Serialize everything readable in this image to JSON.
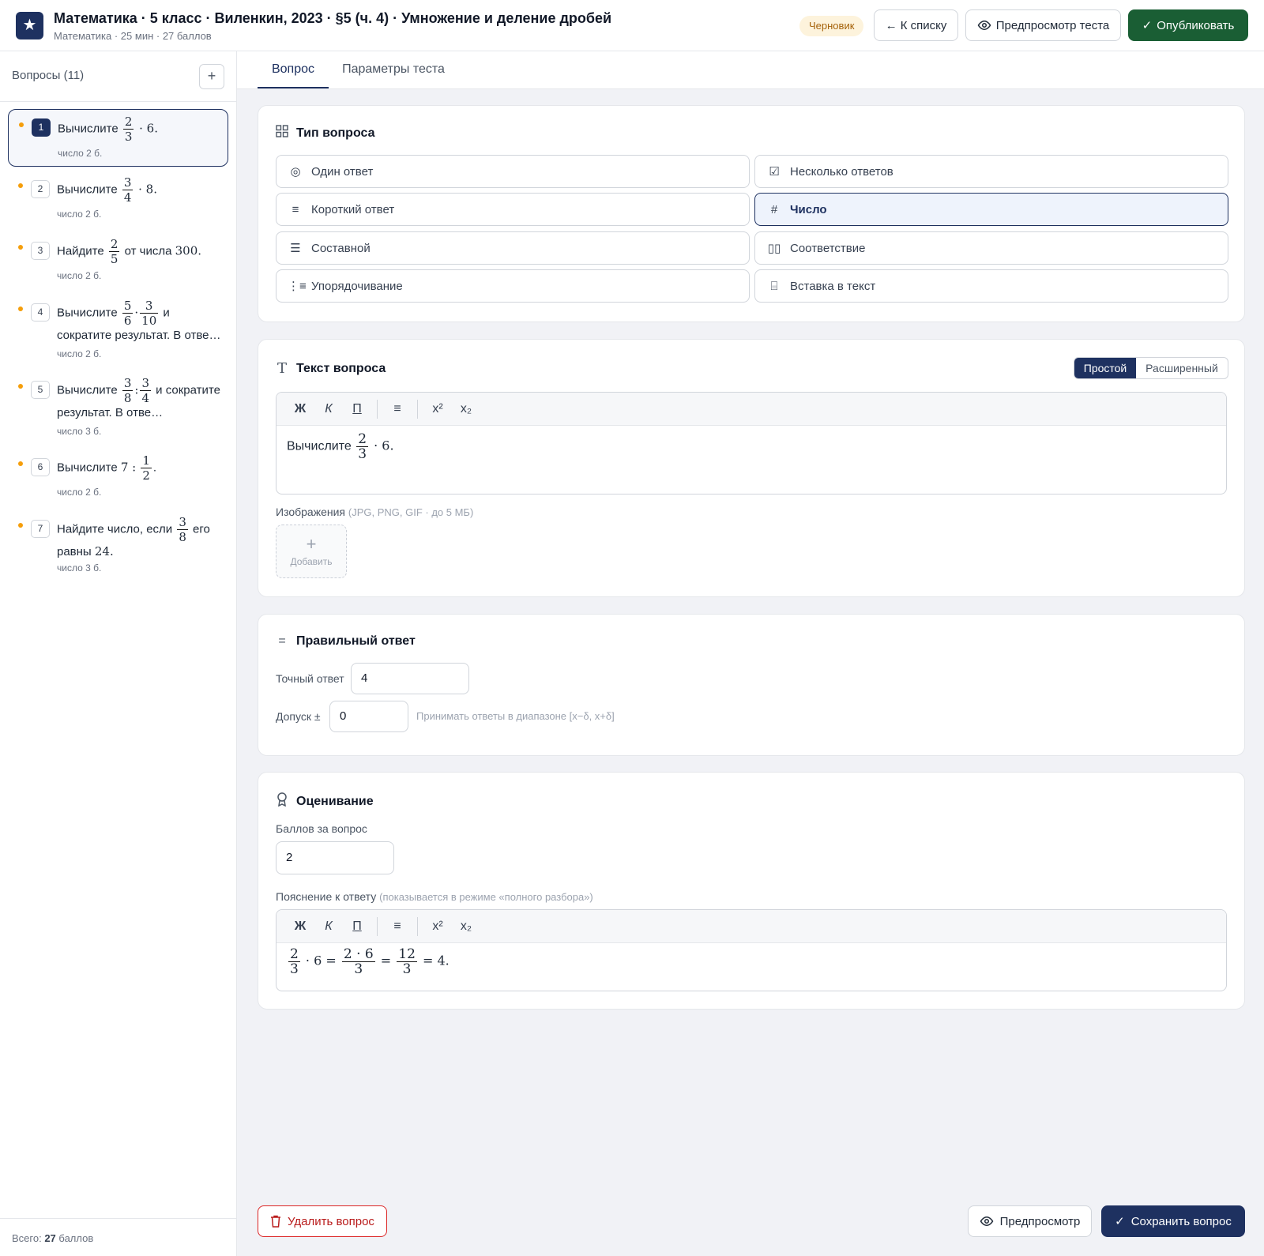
{
  "header": {
    "logo_icon": "star-icon",
    "title": "Математика · 5 класс · Виленкин, 2023 · §5 (ч. 4) · Умножение и деление дробей",
    "subtitle": "Математика · 25 мин · 27 баллов",
    "status": "Черновик",
    "back_label": "← К списку",
    "preview_label": "Предпросмотр теста",
    "publish_label": "Опубликовать"
  },
  "sidebar": {
    "title": "Вопросы (11)",
    "add_label": "+",
    "total_prefix": "Всего:",
    "total_value": "27",
    "total_suffix": "баллов",
    "questions": [
      {
        "num": "1",
        "meta": "число  2 б."
      },
      {
        "num": "2",
        "meta": "число  2 б."
      },
      {
        "num": "3",
        "meta": "число  2 б."
      },
      {
        "num": "4",
        "meta": "число  2 б."
      },
      {
        "num": "5",
        "meta": "число  3 б."
      },
      {
        "num": "6",
        "meta": "число  2 б."
      },
      {
        "num": "7",
        "meta": "число  3 б."
      }
    ]
  },
  "tabs": {
    "question": "Вопрос",
    "params": "Параметры теста"
  },
  "type_card": {
    "title": "Тип вопроса",
    "options": [
      "Один ответ",
      "Несколько ответов",
      "Короткий ответ",
      "Число",
      "Составной",
      "Соответствие",
      "Упорядочивание",
      "Вставка в текст"
    ],
    "selected": "Число"
  },
  "text_card": {
    "title": "Текст вопроса",
    "mode_simple": "Простой",
    "mode_advanced": "Расширенный",
    "toolbar": {
      "bold": "Ж",
      "italic": "К",
      "underline": "П",
      "list": "≡",
      "sup": "x²",
      "sub": "x₂"
    },
    "question_prefix": "Вычислите",
    "images_label": "Изображения",
    "images_hint": "(JPG, PNG, GIF · до 5 МБ)",
    "add_plus": "+",
    "add_label": "Добавить"
  },
  "answer_card": {
    "title": "Правильный ответ",
    "exact_label": "Точный ответ",
    "exact_value": "4",
    "tolerance_label": "Допуск ±",
    "tolerance_value": "0",
    "tolerance_hint": "Принимать ответы в диапазоне [x−δ, x+δ]"
  },
  "grading_card": {
    "title": "Оценивание",
    "points_label": "Баллов за вопрос",
    "points_value": "2",
    "explain_label": "Пояснение к ответу",
    "explain_hint": "(показывается в режиме «полного разбора»)"
  },
  "footer": {
    "delete_label": "Удалить вопрос",
    "preview_label": "Предпросмотр",
    "save_label": "Сохранить вопрос"
  },
  "colors": {
    "navy": "#1e3160",
    "green": "#1a5e34",
    "amber": "#f59e0b",
    "danger": "#dc2626"
  }
}
